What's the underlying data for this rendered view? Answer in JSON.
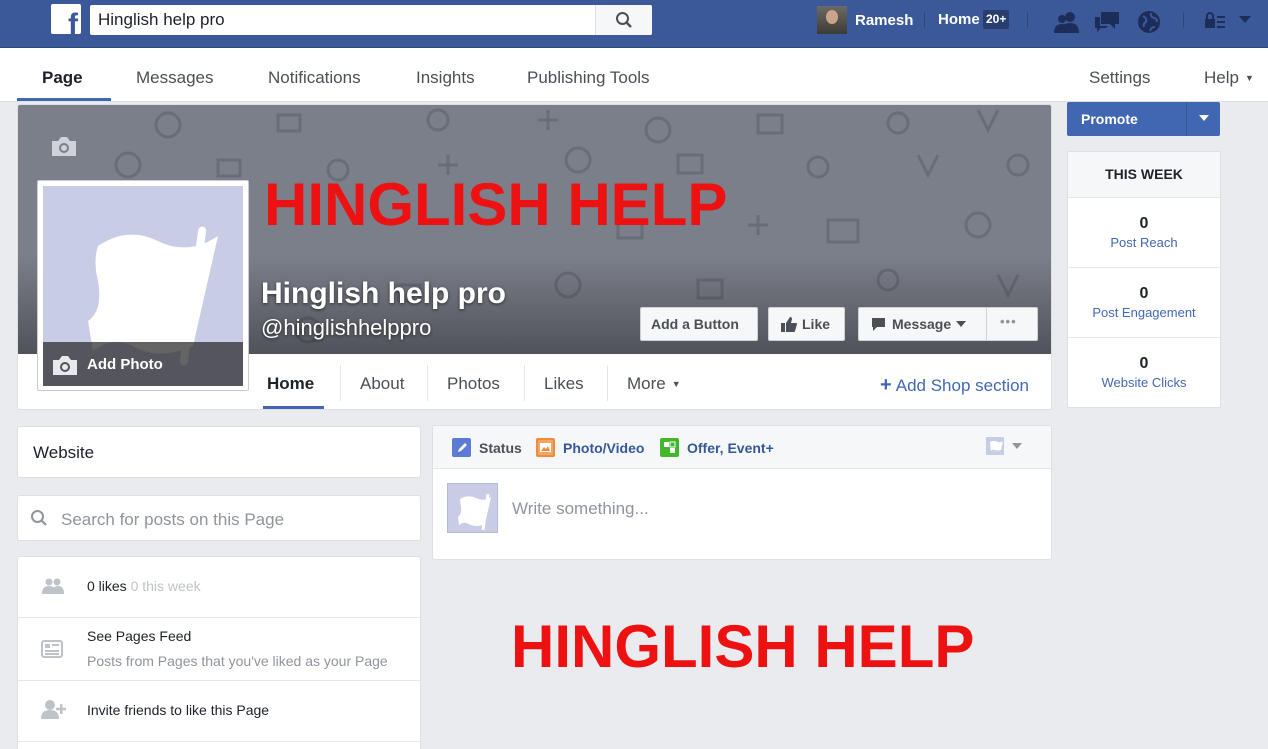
{
  "topbar": {
    "search_query": "Hinglish help pro",
    "user_name": "Ramesh",
    "home_label": "Home",
    "home_badge": "20+",
    "brand_color": "#3b5998"
  },
  "page_tabs": {
    "page": "Page",
    "messages": "Messages",
    "notifications": "Notifications",
    "insights": "Insights",
    "publishing_tools": "Publishing Tools",
    "settings": "Settings",
    "help": "Help"
  },
  "cover": {
    "overlay_text": "HINGLISH HELP",
    "page_name": "Hinglish help pro",
    "page_handle": "@hinglishhelppro",
    "add_photo": "Add Photo",
    "buttons": {
      "add_button": "Add a Button",
      "like": "Like",
      "message": "Message",
      "more": "•••"
    }
  },
  "page_subtabs": {
    "home": "Home",
    "about": "About",
    "photos": "Photos",
    "likes": "Likes",
    "more": "More",
    "add_shop": "Add Shop section"
  },
  "right_column": {
    "promote": "Promote",
    "this_week": "THIS WEEK",
    "stats": [
      {
        "value": "0",
        "label": "Post Reach"
      },
      {
        "value": "0",
        "label": "Post Engagement"
      },
      {
        "value": "0",
        "label": "Website Clicks"
      }
    ]
  },
  "left_column": {
    "website": "Website",
    "search_placeholder": "Search for posts on this Page",
    "likes_count": "0 likes",
    "likes_week": "0 this week",
    "pages_feed_title": "See Pages Feed",
    "pages_feed_desc": "Posts from Pages that you've liked as your Page",
    "invite": "Invite friends to like this Page"
  },
  "composer": {
    "status": "Status",
    "photo_video": "Photo/Video",
    "offer_event": "Offer, Event+",
    "placeholder": "Write something..."
  },
  "watermark": {
    "text": "HINGLISH HELP",
    "color": "#ee1111"
  }
}
